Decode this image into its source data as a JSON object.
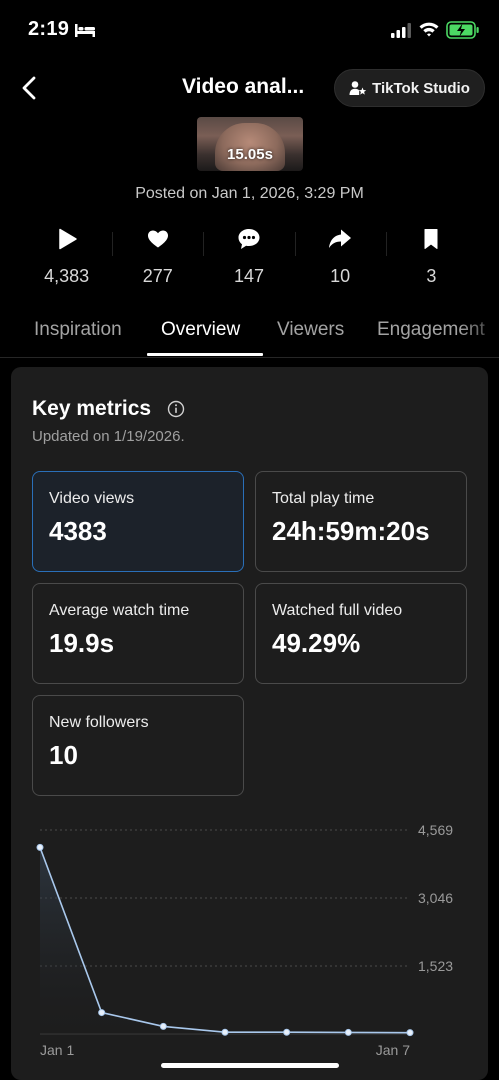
{
  "status_bar": {
    "time": "2:19",
    "icons": [
      "bed-icon",
      "signal-icon",
      "wifi-icon",
      "battery-charging-icon"
    ],
    "battery_color": "#4cd964"
  },
  "header": {
    "title": "Video anal...",
    "back_icon": "chevron-left-icon",
    "studio_button_label": "TikTok Studio",
    "studio_icon": "user-star-icon"
  },
  "video": {
    "duration": "15.05s",
    "posted": "Posted on Jan 1, 2026, 3:29 PM"
  },
  "stats": [
    {
      "icon": "play-icon",
      "value": "4,383"
    },
    {
      "icon": "heart-icon",
      "value": "277"
    },
    {
      "icon": "comment-icon",
      "value": "147"
    },
    {
      "icon": "share-icon",
      "value": "10"
    },
    {
      "icon": "bookmark-icon",
      "value": "3"
    }
  ],
  "tabs": [
    "Inspiration",
    "Overview",
    "Viewers",
    "Engagement"
  ],
  "active_tab": "Overview",
  "key_metrics": {
    "title": "Key metrics",
    "info_icon": "info-icon",
    "updated": "Updated on 1/19/2026.",
    "metrics": [
      {
        "label": "Video views",
        "value": "4383",
        "selected": true
      },
      {
        "label": "Total play time",
        "value": "24h:59m:20s",
        "selected": false
      },
      {
        "label": "Average watch time",
        "value": "19.9s",
        "selected": false
      },
      {
        "label": "Watched full video",
        "value": "49.29%",
        "selected": false
      },
      {
        "label": "New followers",
        "value": "10",
        "selected": false
      }
    ]
  },
  "chart_data": {
    "type": "line",
    "x": [
      "Jan 1",
      "Jan 2",
      "Jan 3",
      "Jan 4",
      "Jan 5",
      "Jan 6",
      "Jan 7"
    ],
    "series": [
      {
        "values": [
          4180,
          480,
          170,
          40,
          40,
          35,
          30
        ]
      }
    ],
    "y_ticks": [
      "1,523",
      "3,046",
      "4,569"
    ],
    "x_tick_labels": [
      "Jan 1",
      "Jan 7"
    ],
    "ylim": [
      0,
      4569
    ],
    "grid": true,
    "colors": {
      "line": "#a9c8ec"
    }
  }
}
